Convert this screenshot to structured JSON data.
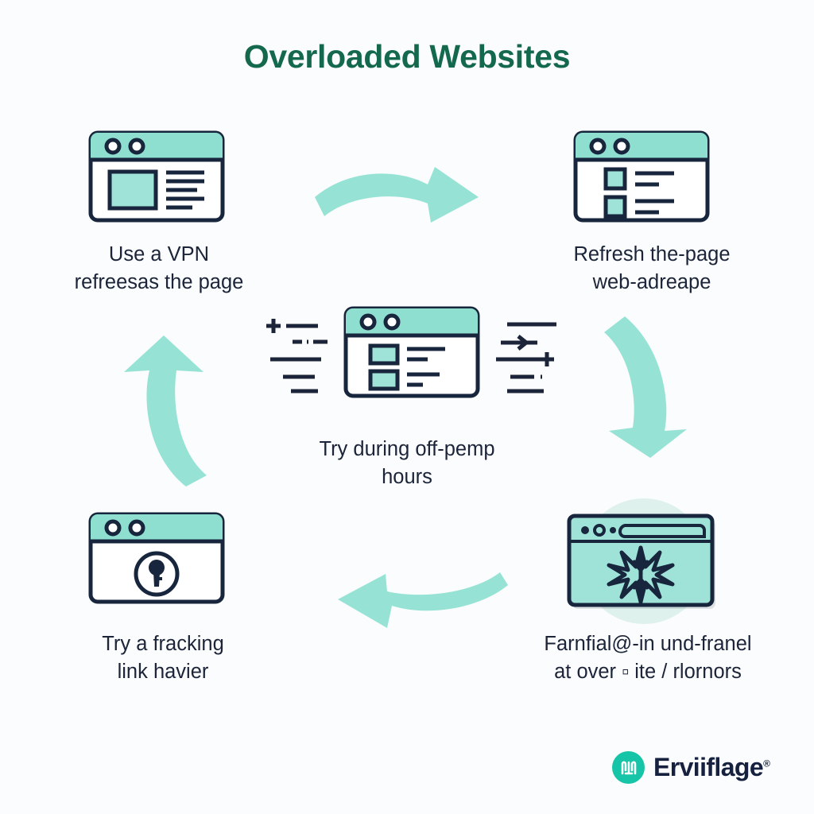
{
  "title": "Overloaded Websites",
  "colors": {
    "background": "#fbfcfd",
    "title_green": "#14694c",
    "teal_fill": "#9fe3d8",
    "teal_arrow": "#96e3d6",
    "teal_header": "#8fdfd0",
    "outline_navy": "#17263d",
    "label_navy": "#1b2438",
    "logo_teal": "#16c5a8",
    "halo": "#d8eeea"
  },
  "nodes": [
    {
      "id": "top-left",
      "label": "Use a VPN\nrefreesas the page",
      "icon": "browser-window-with-media-block-icon"
    },
    {
      "id": "top-right",
      "label": "Refresh the-page\nweb-adreape",
      "icon": "browser-window-with-list-icon"
    },
    {
      "id": "center",
      "label": "Try during off-pemp\nhours",
      "icon": "browser-window-with-rows-icon"
    },
    {
      "id": "bottom-left",
      "label": "Try a fracking\nlink havier",
      "icon": "browser-window-with-keyhole-icon"
    },
    {
      "id": "bottom-right",
      "label": "Farnfial@-in und-franel\nat over ▫ ite / rlornors",
      "icon": "browser-window-with-starburst-icon"
    }
  ],
  "arrows": [
    {
      "id": "top",
      "direction": "right",
      "name": "curved-arrow-right-icon"
    },
    {
      "id": "right",
      "direction": "down",
      "name": "curved-arrow-down-icon"
    },
    {
      "id": "bottom",
      "direction": "left",
      "name": "curved-arrow-left-icon"
    },
    {
      "id": "left",
      "direction": "up",
      "name": "curved-arrow-up-icon"
    }
  ],
  "decorations": {
    "left_marks": "plus-dash-lines-icon",
    "right_marks": "lines-arrow-plus-dot-icon"
  },
  "logo": {
    "text": "Erviiflage",
    "registered_mark": "®",
    "badge_glyph": "M"
  }
}
